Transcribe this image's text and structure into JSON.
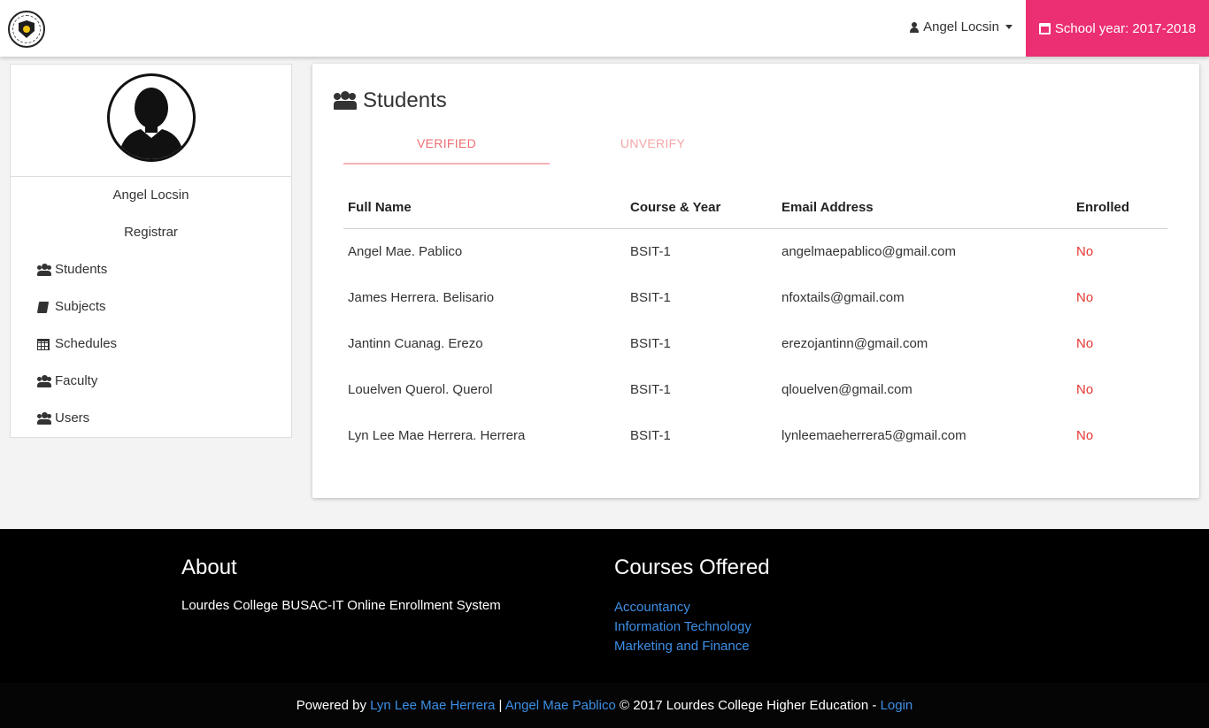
{
  "header": {
    "user_name": "Angel Locsin",
    "school_year_label": "School year: 2017-2018"
  },
  "sidebar": {
    "name": "Angel Locsin",
    "role": "Registrar",
    "items": [
      {
        "label": "Students",
        "icon": "users-icon"
      },
      {
        "label": "Subjects",
        "icon": "book-icon"
      },
      {
        "label": "Schedules",
        "icon": "calendar-icon"
      },
      {
        "label": "Faculty",
        "icon": "users-icon"
      },
      {
        "label": "Users",
        "icon": "users-icon"
      }
    ]
  },
  "main": {
    "title": "Students",
    "tabs": [
      {
        "label": "VERIFIED",
        "active": true
      },
      {
        "label": "UNVERIFY",
        "active": false
      }
    ],
    "table": {
      "headers": [
        "Full Name",
        "Course & Year",
        "Email Address",
        "Enrolled"
      ],
      "rows": [
        [
          "Angel Mae. Pablico",
          "BSIT-1",
          "angelmaepablico@gmail.com",
          "No"
        ],
        [
          "James Herrera. Belisario",
          "BSIT-1",
          "nfoxtails@gmail.com",
          "No"
        ],
        [
          "Jantinn Cuanag. Erezo",
          "BSIT-1",
          "erezojantinn@gmail.com",
          "No"
        ],
        [
          "Louelven Querol. Querol",
          "BSIT-1",
          "qlouelven@gmail.com",
          "No"
        ],
        [
          "Lyn Lee Mae Herrera. Herrera",
          "BSIT-1",
          "lynleemaeherrera5@gmail.com",
          "No"
        ]
      ]
    }
  },
  "footer": {
    "about_title": "About",
    "about_text": "Lourdes College BUSAC-IT Online Enrollment System",
    "courses_title": "Courses Offered",
    "courses": [
      "Accountancy",
      "Information Technology",
      "Marketing and Finance"
    ],
    "copyright": {
      "prefix": "Powered by",
      "author1": "Lyn Lee Mae Herrera",
      "separator": "|",
      "author2": "Angel Mae Pablico",
      "suffix": "© 2017 Lourdes College Higher Education -",
      "login": "Login"
    }
  },
  "colors": {
    "accent": "#ec2e73",
    "tab_active": "#ee6e73",
    "enrolled_no": "#e53935",
    "link": "#3d8fe6"
  }
}
